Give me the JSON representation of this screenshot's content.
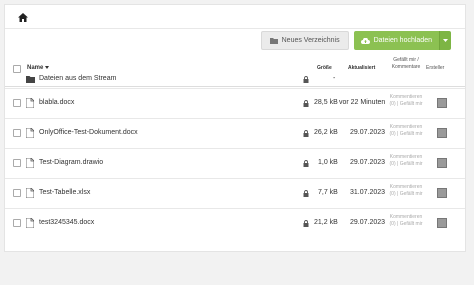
{
  "toolbar": {
    "new_dir_label": "Neues Verzeichnis",
    "upload_label": "Dateien hochladen"
  },
  "table": {
    "headers": {
      "name": "Name",
      "size": "Größe",
      "updated": "Aktualisiert",
      "likes_comments": "Gefällt mir / Kommentare",
      "creator": "Ersteller"
    },
    "rows": [
      {
        "name": "Dateien aus dem Stream",
        "type": "folder",
        "size": "",
        "updated": "-",
        "social": ""
      },
      {
        "name": "blabla.docx",
        "type": "file",
        "size": "28,5 kB",
        "updated": "vor 22 Minuten",
        "social": "Kommentieren (0) | Gefällt mir"
      },
      {
        "name": "OnlyOffice-Test-Dokument.docx",
        "type": "file",
        "size": "26,2 kB",
        "updated": "29.07.2023",
        "social": "Kommentieren (0) | Gefällt mir"
      },
      {
        "name": "Test-Diagram.drawio",
        "type": "file",
        "size": "1,0 kB",
        "updated": "29.07.2023",
        "social": "Kommentieren (0) | Gefällt mir"
      },
      {
        "name": "Test-Tabelle.xlsx",
        "type": "file",
        "size": "7,7 kB",
        "updated": "31.07.2023",
        "social": "Kommentieren (0) | Gefällt mir"
      },
      {
        "name": "test3245345.docx",
        "type": "file",
        "size": "21,2 kB",
        "updated": "29.07.2023",
        "social": "Kommentieren (0) | Gefällt mir"
      }
    ]
  },
  "colors": {
    "upload_green": "#8cc152",
    "border": "#e8e8e8"
  },
  "icons": {
    "home": "home-icon",
    "folder": "folder-icon",
    "file": "file-icon",
    "lock": "lock-icon",
    "upload": "cloud-upload-icon",
    "dropdown": "caret-down-icon",
    "sort": "sort-down-icon"
  }
}
